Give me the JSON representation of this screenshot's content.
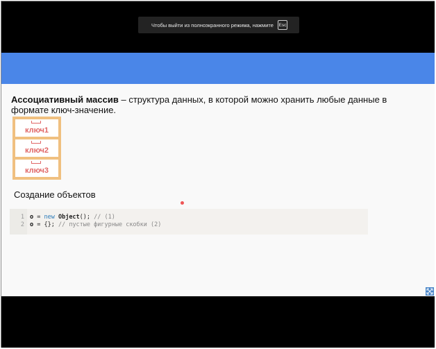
{
  "fullscreen_notice": {
    "text": "Чтобы выйти из полноэкранного режима, нажмите",
    "key": "Esc"
  },
  "slide": {
    "definition_term": "Ассоциативный массив",
    "definition_rest": " – структура данных, в которой можно хранить любые данные в формате ключ-значение.",
    "drawers": [
      "ключ1",
      "ключ2",
      "ключ3"
    ],
    "subheading": "Создание объектов",
    "code": {
      "line_numbers": [
        "1",
        "2"
      ],
      "line1": {
        "var": "o",
        "op": " = ",
        "kw": "new",
        "cls": " Object",
        "rest": "(); ",
        "comment": "// (1)"
      },
      "line2": {
        "var": "o",
        "op": " = ",
        "rest": "{}; ",
        "comment": "// пустые фигурные скобки (2)"
      }
    }
  },
  "colors": {
    "blue_bar": "#4a86e8",
    "drawer_label": "#e06666",
    "cabinet": "#f0c080"
  },
  "icons": {
    "corner": "expand-icon"
  }
}
